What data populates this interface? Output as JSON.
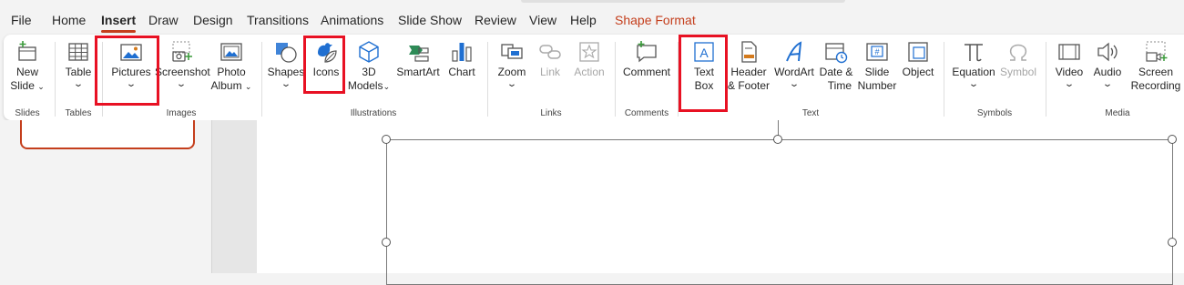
{
  "tabs": [
    "File",
    "Home",
    "Insert",
    "Draw",
    "Design",
    "Transitions",
    "Animations",
    "Slide Show",
    "Review",
    "View",
    "Help",
    "Shape Format"
  ],
  "groups": {
    "slides": "Slides",
    "tables": "Tables",
    "images": "Images",
    "illustrations": "Illustrations",
    "links": "Links",
    "comments": "Comments",
    "text": "Text",
    "symbols": "Symbols",
    "media": "Media"
  },
  "buttons": {
    "new_slide": [
      "New",
      "Slide"
    ],
    "table": "Table",
    "pictures": "Pictures",
    "screenshot": "Screenshot",
    "photo_album": [
      "Photo",
      "Album"
    ],
    "shapes": "Shapes",
    "icons": "Icons",
    "models_3d": [
      "3D",
      "Models"
    ],
    "smartart": "SmartArt",
    "chart": "Chart",
    "zoom": "Zoom",
    "link": "Link",
    "action": "Action",
    "comment": "Comment",
    "text_box": [
      "Text",
      "Box"
    ],
    "header_footer": [
      "Header",
      "& Footer"
    ],
    "wordart": "WordArt",
    "date_time": [
      "Date &",
      "Time"
    ],
    "slide_number": [
      "Slide",
      "Number"
    ],
    "object": "Object",
    "equation": "Equation",
    "symbol": "Symbol",
    "video": "Video",
    "audio": "Audio",
    "screen_recording": [
      "Screen",
      "Recording"
    ]
  },
  "colors": {
    "accent": "#c43e1c",
    "highlight": "#e81123",
    "icon_blue": "#1f6fd1"
  }
}
